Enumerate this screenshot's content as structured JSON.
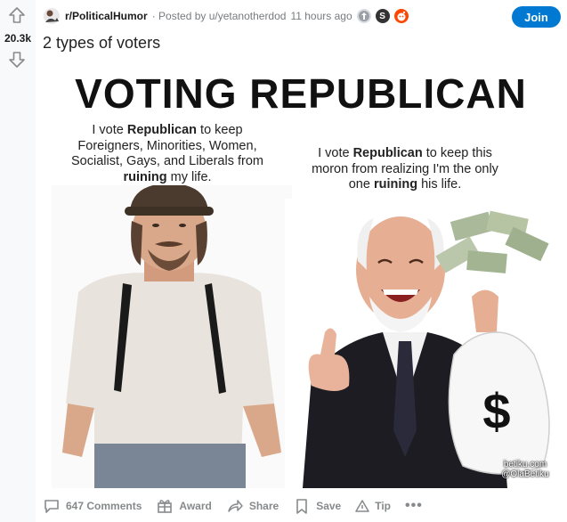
{
  "vote": {
    "count": "20.3k"
  },
  "meta": {
    "subreddit": "r/PoliticalHumor",
    "posted_by": "· Posted by u/yetanotherdod",
    "time": "11 hours ago"
  },
  "join_label": "Join",
  "title": "2 types of voters",
  "meme": {
    "headline": "VOTING REPUBLICAN",
    "left_caption": {
      "p1": "I vote ",
      "b1": "Republican",
      "p2": " to keep Foreigners, Minorities, Women, Socialist, Gays, and Liberals from ",
      "b2": "ruining",
      "p3": " my life."
    },
    "right_caption": {
      "p1": "I vote ",
      "b1": "Republican",
      "p2": " to keep this moron from realizing I'm the only one ",
      "b2": "ruining",
      "p3": " his life."
    },
    "watermark_line1": "betiku.com",
    "watermark_line2": "@OlaBetiku",
    "money_symbol": "$"
  },
  "actions": {
    "comments": "647 Comments",
    "award": "Award",
    "share": "Share",
    "save": "Save",
    "tip": "Tip",
    "more": "•••"
  },
  "colors": {
    "accent": "#0079d3",
    "muted": "#878a8c",
    "vote_bg": "#f8f9fa"
  }
}
